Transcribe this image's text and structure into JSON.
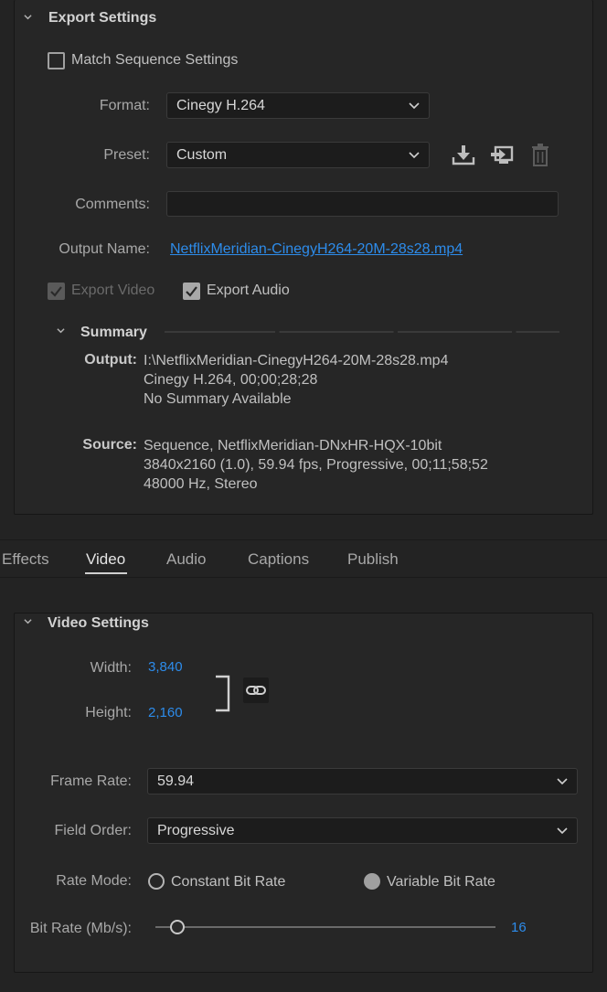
{
  "export_settings": {
    "title": "Export Settings",
    "match_sequence": {
      "label": "Match Sequence Settings",
      "checked": false
    },
    "format": {
      "label": "Format:",
      "value": "Cinegy H.264"
    },
    "preset": {
      "label": "Preset:",
      "value": "Custom"
    },
    "comments": {
      "label": "Comments:",
      "value": ""
    },
    "output_name": {
      "label": "Output Name:",
      "value": "NetflixMeridian-CinegyH264-20M-28s28.mp4"
    },
    "export_video": {
      "label": "Export Video",
      "checked": true,
      "disabled": true
    },
    "export_audio": {
      "label": "Export Audio",
      "checked": true
    },
    "summary": {
      "title": "Summary",
      "output_key": "Output:",
      "output_lines": [
        "I:\\NetflixMeridian-CinegyH264-20M-28s28.mp4",
        "Cinegy H.264, 00;00;28;28",
        "No Summary Available"
      ],
      "source_key": "Source:",
      "source_lines": [
        "Sequence, NetflixMeridian-DNxHR-HQX-10bit",
        "3840x2160 (1.0), 59.94 fps, Progressive, 00;11;58;52",
        "48000 Hz, Stereo"
      ]
    }
  },
  "tabs": [
    {
      "label": "Effects",
      "active": false
    },
    {
      "label": "Video",
      "active": true
    },
    {
      "label": "Audio",
      "active": false
    },
    {
      "label": "Captions",
      "active": false
    },
    {
      "label": "Publish",
      "active": false
    }
  ],
  "video_settings": {
    "title": "Video Settings",
    "width": {
      "label": "Width:",
      "value": "3,840"
    },
    "height": {
      "label": "Height:",
      "value": "2,160"
    },
    "frame_rate": {
      "label": "Frame Rate:",
      "value": "59.94"
    },
    "field_order": {
      "label": "Field Order:",
      "value": "Progressive"
    },
    "rate_mode": {
      "label": "Rate Mode:",
      "options": [
        "Constant Bit Rate",
        "Variable Bit Rate"
      ],
      "selected": "Variable Bit Rate"
    },
    "bit_rate": {
      "label": "Bit Rate (Mb/s):",
      "value": "16",
      "slider_fraction": 0.04
    }
  },
  "colors": {
    "background": "#232323",
    "panel": "#262626",
    "accent_blue": "#2d8ceb",
    "text": "#b4b4b4"
  },
  "icons": [
    "chevron-down-icon",
    "save-preset-icon",
    "import-preset-icon",
    "delete-preset-icon",
    "link-icon"
  ]
}
